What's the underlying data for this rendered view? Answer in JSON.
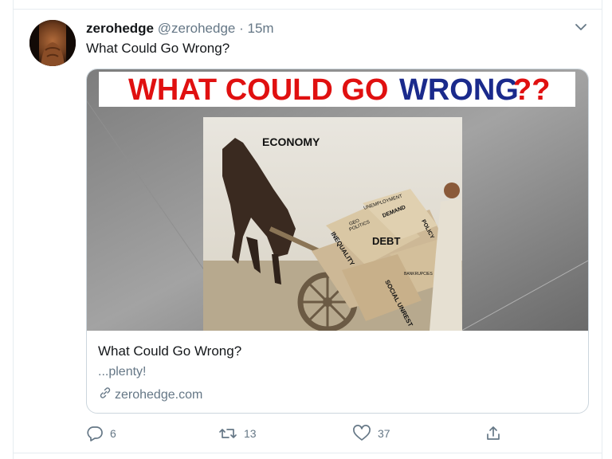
{
  "tweet": {
    "display_name": "zerohedge",
    "handle": "@zerohedge",
    "separator": "·",
    "time": "15m",
    "text": "What Could Go Wrong?"
  },
  "card": {
    "banner_text": "WHAT COULD GO WRONG??",
    "image_labels": {
      "economy": "ECONOMY",
      "unemployment": "UNEMPLOYMENT",
      "geo_politics_1": "GEO",
      "geo_politics_2": "POLITICS",
      "demand": "DEMAND",
      "policy": "POLICY",
      "debt": "DEBT",
      "inequality": "INEQUALITY",
      "bankrupcies": "BANKRUPCIES",
      "social_unrest": "SOCIAL UNREST"
    },
    "title": "What Could Go Wrong?",
    "description": "...plenty!",
    "domain": "zerohedge.com"
  },
  "actions": {
    "replies": "6",
    "retweets": "13",
    "likes": "37"
  },
  "icons": {
    "avatar": "avatar",
    "chevron": "chevron-down-icon",
    "reply": "reply-icon",
    "retweet": "retweet-icon",
    "like": "heart-icon",
    "share": "share-icon",
    "link": "link-icon"
  },
  "colors": {
    "secondary_text": "#657786",
    "banner_red": "#e01010",
    "banner_blue": "#1a2a8c"
  }
}
